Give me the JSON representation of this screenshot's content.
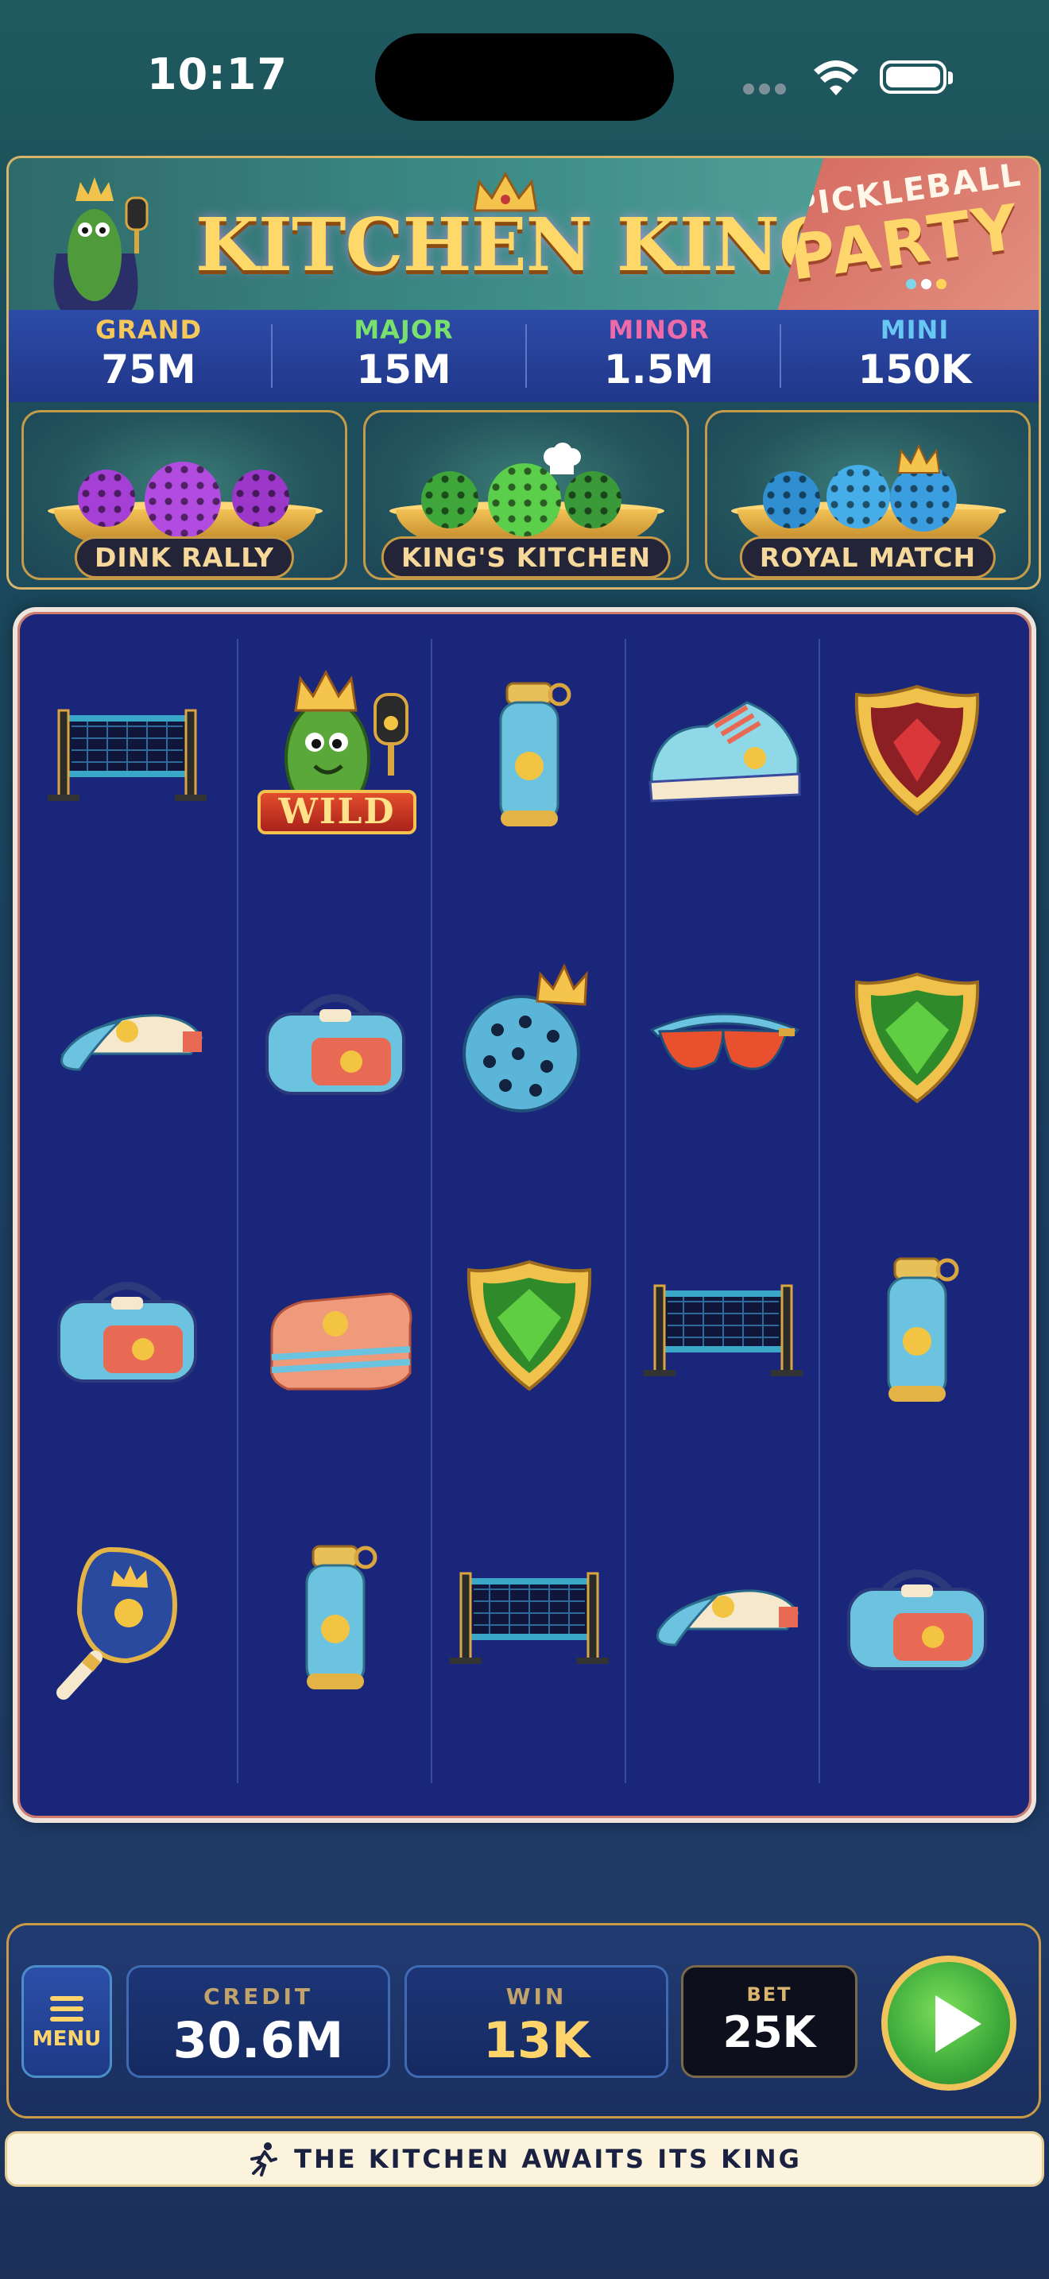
{
  "status_bar": {
    "time": "10:17"
  },
  "banner": {
    "title": "KITCHEN KING",
    "badge_top": "PICKLEBALL",
    "badge_main": "PARTY"
  },
  "jackpots": [
    {
      "label": "GRAND",
      "value": "75M",
      "color": "#f4c85a"
    },
    {
      "label": "MAJOR",
      "value": "15M",
      "color": "#79e06e"
    },
    {
      "label": "MINOR",
      "value": "1.5M",
      "color": "#ef6aa8"
    },
    {
      "label": "MINI",
      "value": "150K",
      "color": "#67c7f2"
    }
  ],
  "features": [
    {
      "label": "DINK RALLY",
      "ball_color": "#a63fd6"
    },
    {
      "label": "KING'S KITCHEN",
      "ball_color": "#4cc04a"
    },
    {
      "label": "ROYAL MATCH",
      "ball_color": "#38a4e3"
    }
  ],
  "reels": {
    "rows": [
      [
        "net-icon",
        "pickle-king-wild-icon",
        "water-bottle-icon",
        "sneaker-icon",
        "red-gem-shield-icon"
      ],
      [
        "visor-icon",
        "gym-bag-icon",
        "crowned-pickleball-icon",
        "sunglasses-icon",
        "green-gem-shield-icon"
      ],
      [
        "gym-bag-icon",
        "towel-icon",
        "green-gem-shield-icon",
        "net-icon",
        "water-bottle-icon"
      ],
      [
        "crown-paddle-icon",
        "water-bottle-icon",
        "net-icon",
        "visor-icon",
        "gym-bag-icon"
      ]
    ],
    "wild_label": "WILD"
  },
  "controls": {
    "menu_label": "MENU",
    "credit_label": "CREDIT",
    "credit_value": "30.6M",
    "win_label": "WIN",
    "win_value": "13K",
    "bet_label": "BET",
    "bet_value": "25K"
  },
  "ticker": {
    "message": "THE KITCHEN AWAITS ITS KING"
  }
}
